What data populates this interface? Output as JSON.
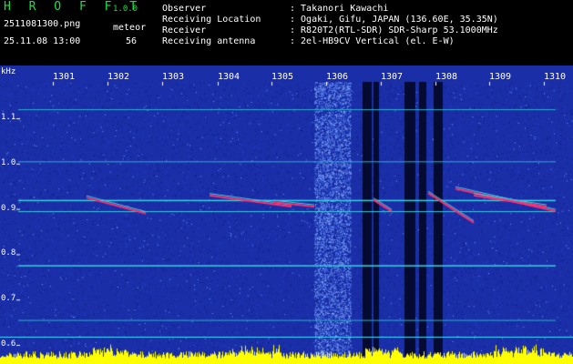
{
  "header": {
    "logo": "H R O F F T",
    "version": "1.0.0",
    "filename": "2511081300.png",
    "timestamp": "25.11.08 13:00",
    "meteor_label": "meteor",
    "meteor_count": "56",
    "info": [
      {
        "label": "Observer",
        "value": ": Takanori Kawachi"
      },
      {
        "label": "Receiving Location",
        "value": ": Ogaki, Gifu, JAPAN (136.60E, 35.35N)"
      },
      {
        "label": "Receiver",
        "value": ": R820T2(RTL-SDR) SDR-Sharp 53.1000MHz"
      },
      {
        "label": "Receiving antenna",
        "value": ": 2el-HB9CV Vertical (el. E-W)"
      }
    ]
  },
  "spectrogram": {
    "unit": "kHz",
    "y_ticks": [
      "1.1",
      "1.0",
      "0.9",
      "0.8",
      "0.7",
      "0.6"
    ],
    "y_values": [
      1.1,
      1.0,
      0.9,
      0.8,
      0.7,
      0.6
    ],
    "x_ticks": [
      "1301",
      "1302",
      "1303",
      "1304",
      "1305",
      "1306",
      "1307",
      "1308",
      "1309",
      "1310"
    ],
    "colors": {
      "background": "#1a2ea8",
      "trace": "#3ad0e0",
      "meteor": "#ff3070",
      "level": "#ffff00"
    }
  }
}
